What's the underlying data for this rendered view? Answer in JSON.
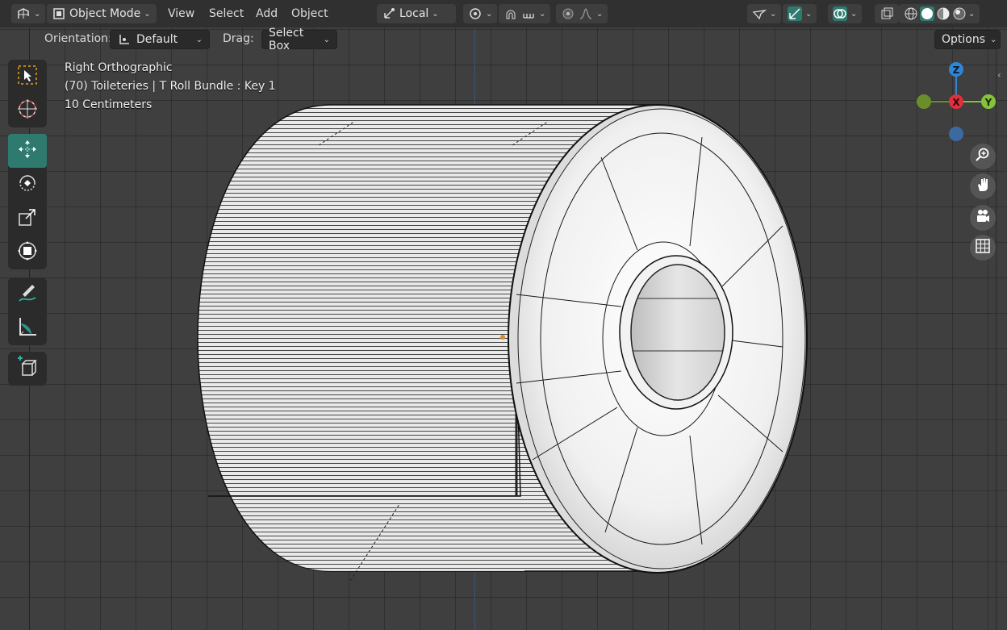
{
  "header": {
    "editor_type_icon": "viewport-editor-icon",
    "mode_label": "Object Mode",
    "menus": [
      "View",
      "Select",
      "Add",
      "Object"
    ],
    "transform_orientation": "Local",
    "options_label": "Options"
  },
  "tool_settings": {
    "orientation_label": "Orientation:",
    "orientation_value": "Default",
    "drag_label": "Drag:",
    "drag_value": "Select Box"
  },
  "viewport_info": {
    "view_name": "Right Orthographic",
    "object_info": "(70) Toileteries  | T Roll Bundle : Key 1",
    "scale": "10 Centimeters"
  },
  "gizmo": {
    "z_label": "Z",
    "x_label": "X",
    "y_label": "Y",
    "colors": {
      "x": "#e0303c",
      "y": "#86c33c",
      "z": "#2f86d6",
      "neg_y": "#6a8f2a",
      "neg_z": "#3c6aa0"
    }
  },
  "tools": [
    "select-box-icon",
    "cursor-icon",
    "move-icon",
    "rotate-icon",
    "scale-icon",
    "transform-icon",
    "annotate-icon",
    "measure-icon",
    "add-cube-icon"
  ],
  "nav_buttons": [
    "zoom-icon",
    "hand-pan-icon",
    "camera-icon",
    "grid-icon"
  ],
  "colors": {
    "accent": "#2e7a6f",
    "header": "#303030",
    "viewport": "#3f3f3f"
  }
}
